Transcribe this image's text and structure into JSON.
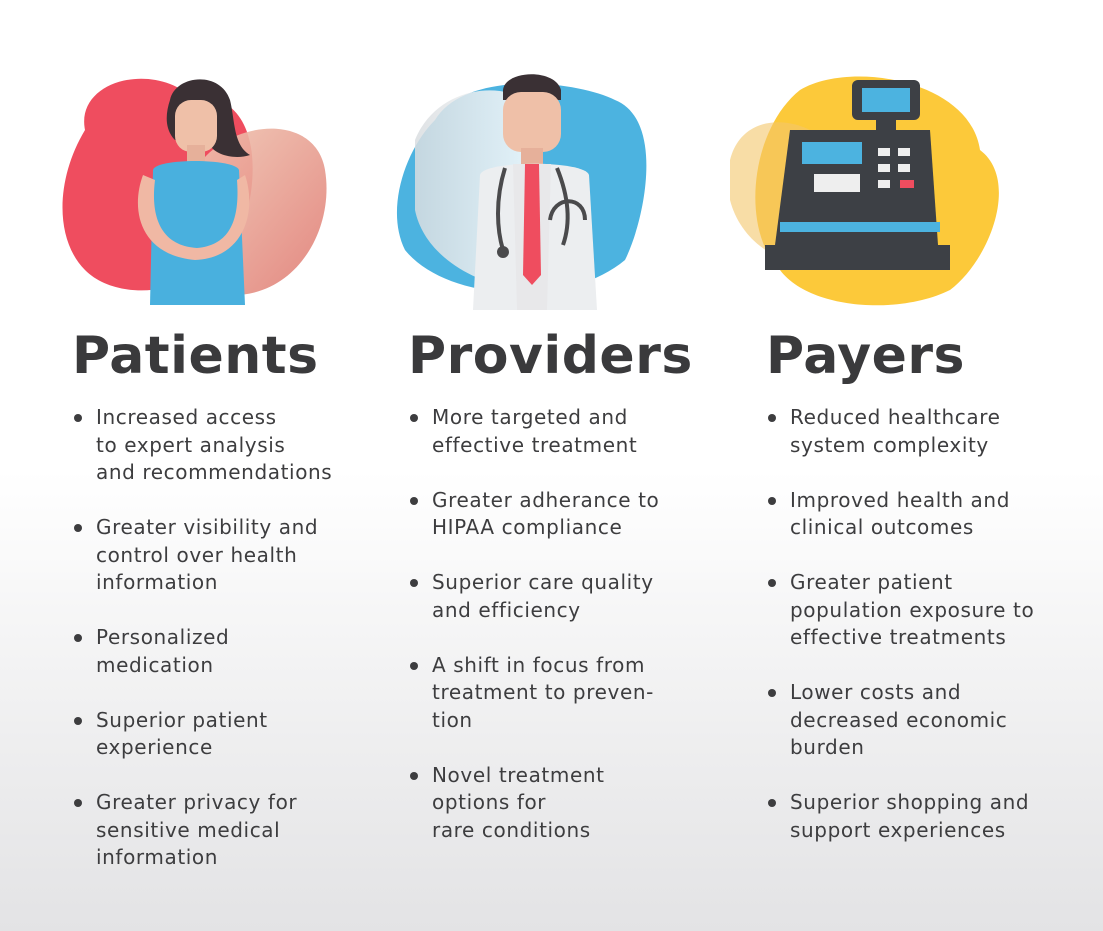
{
  "columns": [
    {
      "title": "Patients",
      "items": [
        "Increased access\nto expert analysis\nand recommendations",
        "Greater visibility and\ncontrol over health\ninformation",
        "Personalized\nmedication",
        "Superior patient\nexperience",
        "Greater privacy for\nsensitive medical\ninformation"
      ]
    },
    {
      "title": "Providers",
      "items": [
        "More targeted and\neffective treatment",
        "Greater adherance to\nHIPAA compliance",
        "Superior care quality\nand efficiency",
        "A shift in focus from\ntreatment to preven-\ntion",
        "",
        "Novel treatment\noptions for\nrare conditions"
      ]
    },
    {
      "title": "Payers",
      "items": [
        "Reduced healthcare\nsystem complexity",
        "Improved health and\nclinical outcomes",
        "Greater patient\npopulation exposure to\neffective treatments",
        "Lower costs and\ndecreased economic\nburden",
        "Superior shopping and\nsupport experiences"
      ]
    }
  ],
  "icons": {
    "patients": "patient-woman-icon",
    "providers": "doctor-icon",
    "payers": "cash-register-icon"
  },
  "colors": {
    "red": "#ef4d5f",
    "peach": "#efb8a2",
    "blue": "#4cb3e0",
    "yellow": "#fcc93a",
    "dark": "#3a3a3c"
  }
}
